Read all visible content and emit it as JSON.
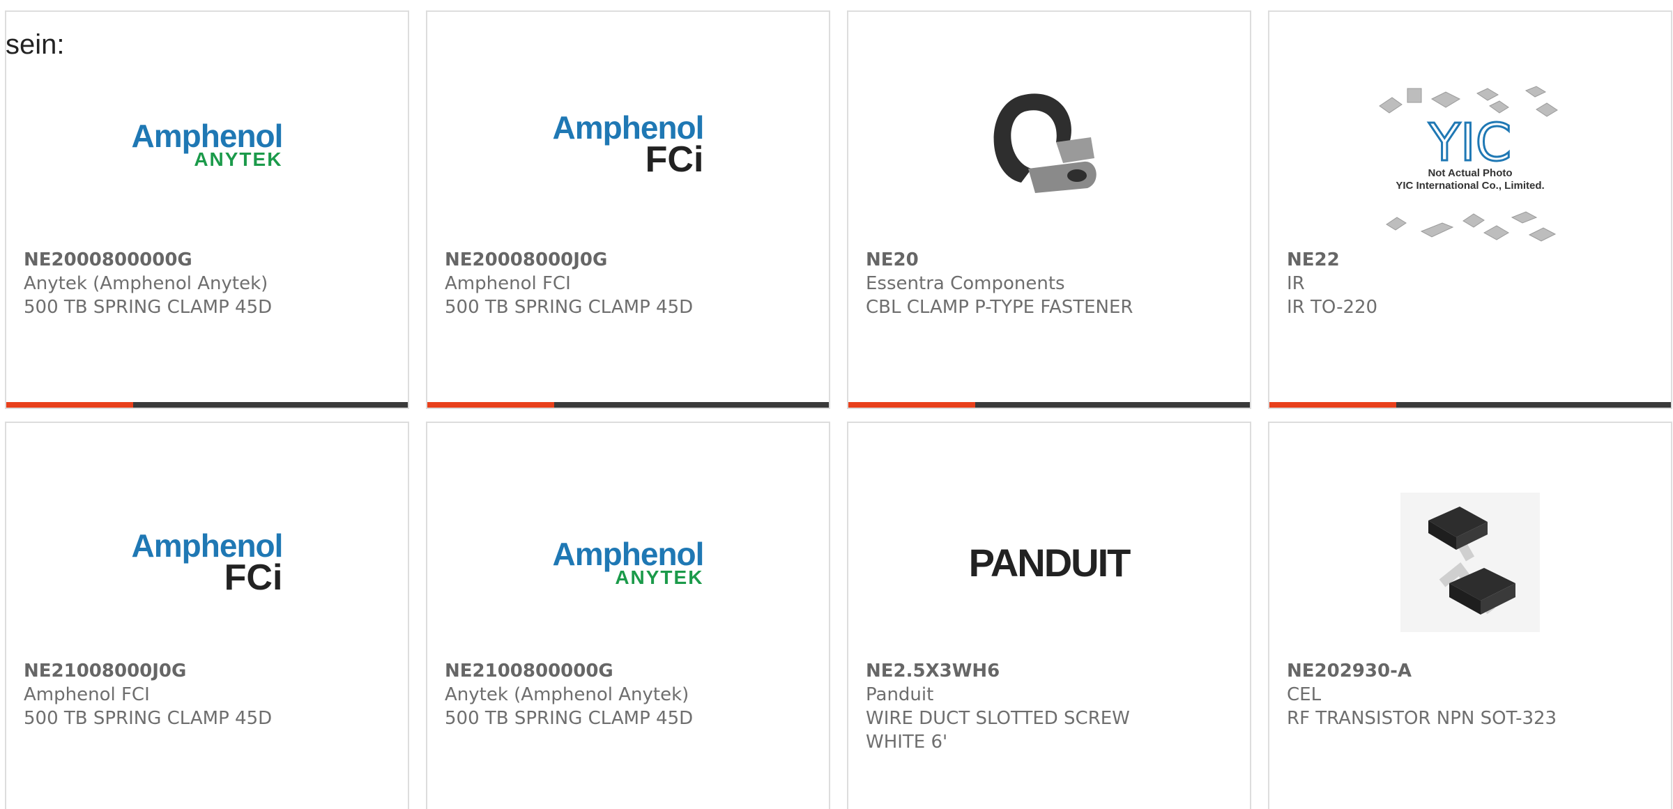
{
  "lead_text": "sein:",
  "theme": {
    "accent": "#e8401c",
    "bar": "#3a3a3a",
    "border": "#dddddd"
  },
  "products": [
    {
      "part_number": "NE2000800000G",
      "manufacturer": "Anytek (Amphenol Anytek)",
      "description_lines": [
        "500 TB SPRING CLAMP 45D"
      ],
      "image": {
        "kind": "logo",
        "name": "amphenol-anytek-logo",
        "text_main": "Amphenol",
        "text_sub": "ANYTEK"
      }
    },
    {
      "part_number": "NE20008000J0G",
      "manufacturer": "Amphenol FCI",
      "description_lines": [
        "500 TB SPRING CLAMP 45D"
      ],
      "image": {
        "kind": "logo",
        "name": "amphenol-fci-logo",
        "text_main": "Amphenol",
        "text_sub": "FCi"
      }
    },
    {
      "part_number": "NE20",
      "manufacturer": "Essentra Components",
      "description_lines": [
        "CBL CLAMP P-TYPE FASTENER"
      ],
      "image": {
        "kind": "photo",
        "name": "cable-clamp-photo"
      }
    },
    {
      "part_number": "NE22",
      "manufacturer": "IR",
      "description_lines": [
        "IR TO-220"
      ],
      "image": {
        "kind": "placeholder",
        "name": "yic-not-actual-photo",
        "text_logo": "YIC",
        "caption_1": "Not Actual Photo",
        "caption_2": "YIC International Co., Limited."
      }
    },
    {
      "part_number": "NE21008000J0G",
      "manufacturer": "Amphenol FCI",
      "description_lines": [
        "500 TB SPRING CLAMP 45D"
      ],
      "image": {
        "kind": "logo",
        "name": "amphenol-fci-logo",
        "text_main": "Amphenol",
        "text_sub": "FCi"
      }
    },
    {
      "part_number": "NE2100800000G",
      "manufacturer": "Anytek (Amphenol Anytek)",
      "description_lines": [
        "500 TB SPRING CLAMP 45D"
      ],
      "image": {
        "kind": "logo",
        "name": "amphenol-anytek-logo",
        "text_main": "Amphenol",
        "text_sub": "ANYTEK"
      }
    },
    {
      "part_number": "NE2.5X3WH6",
      "manufacturer": "Panduit",
      "description_lines": [
        "WIRE DUCT SLOTTED SCREW",
        "WHITE 6'"
      ],
      "image": {
        "kind": "logo",
        "name": "panduit-logo",
        "text_main": "PANDUIT"
      }
    },
    {
      "part_number": "NE202930-A",
      "manufacturer": "CEL",
      "description_lines": [
        "RF TRANSISTOR NPN SOT-323"
      ],
      "image": {
        "kind": "photo",
        "name": "sot323-transistor-photo"
      }
    }
  ]
}
